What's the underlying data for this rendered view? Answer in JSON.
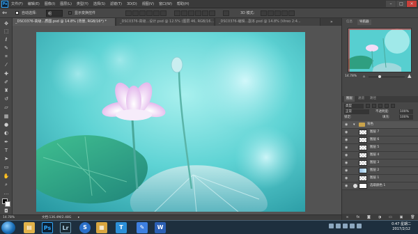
{
  "app": {
    "logo": "Ps"
  },
  "menu": [
    "文件(F)",
    "编辑(E)",
    "图像(I)",
    "图层(L)",
    "类型(Y)",
    "选择(S)",
    "滤镜(T)",
    "3D(D)",
    "视图(V)",
    "窗口(W)",
    "帮助(H)"
  ],
  "options": {
    "auto_select_label": "自动选择:",
    "auto_select_value": "组",
    "show_transform_label": "显示变换控件",
    "mode_3d": "3D 模式:"
  },
  "tabs": [
    {
      "label": "_DSC0376-高级...质图.psd @ 14.8% (背景, RGB/16*) *",
      "active": true
    },
    {
      "label": "_DSC0376-高级...设计.psd @ 12.5% (图层 46, RGB/16...",
      "active": false
    },
    {
      "label": "_DSC0376-编辑...副本.psd @ 14.8% (Vireo 2:4...",
      "active": false
    }
  ],
  "panels": {
    "tabs": [
      "信息",
      "导航器"
    ],
    "zoom": "14.78%",
    "layers_tabs": [
      "图层",
      "通道",
      "路径"
    ],
    "filter_label": "类型",
    "blend_mode": "正常",
    "opacity_label": "不透明度:",
    "opacity_value": "100%",
    "lock_label": "锁定:",
    "fill_label": "填充:",
    "fill_value": "100%",
    "layers": [
      {
        "name": "背色",
        "type": "group"
      },
      {
        "name": "图层 7",
        "type": "layer"
      },
      {
        "name": "图层 6",
        "type": "layer"
      },
      {
        "name": "图层 5",
        "type": "layer"
      },
      {
        "name": "图层 4",
        "type": "layer"
      },
      {
        "name": "图层 3",
        "type": "layer"
      },
      {
        "name": "图层 2",
        "type": "layer"
      },
      {
        "name": "图层 1",
        "type": "layer"
      },
      {
        "name": "选取颜色 1",
        "type": "adjustment"
      }
    ]
  },
  "status": {
    "zoom": "14.78%",
    "doc": "文档:136.4M/2.48G"
  },
  "taskbar": {
    "time": "0:47 星期二",
    "date": "2017/2/12",
    "apps": [
      {
        "name": "explorer",
        "glyph": "▤",
        "color": "#e0b24a"
      },
      {
        "name": "photoshop",
        "glyph": "Ps",
        "color": "#0c2033"
      },
      {
        "name": "lightroom",
        "glyph": "Lr",
        "color": "#1b2a33"
      },
      {
        "name": "browser",
        "glyph": "S",
        "color": "#2a6fc9"
      },
      {
        "name": "folder",
        "glyph": "▦",
        "color": "#d8a640"
      },
      {
        "name": "typora",
        "glyph": "T",
        "color": "#2c8fd8"
      },
      {
        "name": "pen",
        "glyph": "✎",
        "color": "#3d7fe0"
      },
      {
        "name": "word",
        "glyph": "W",
        "color": "#2b5fb4"
      }
    ]
  },
  "colors": {
    "accent": "#31a8ff",
    "background": "#535353",
    "canvas_teal": "#5fd6d6",
    "lotus_pink": "#f2d9f5"
  },
  "icons": {
    "tools": [
      "move-icon",
      "marquee-icon",
      "lasso-icon",
      "quick-select-icon",
      "crop-icon",
      "eyedropper-icon",
      "healing-icon",
      "brush-icon",
      "clone-stamp-icon",
      "history-brush-icon",
      "eraser-icon",
      "gradient-icon",
      "blur-icon",
      "dodge-icon",
      "pen-icon",
      "type-icon",
      "path-select-icon",
      "shape-icon",
      "hand-icon",
      "zoom-icon",
      "more-icon"
    ]
  }
}
